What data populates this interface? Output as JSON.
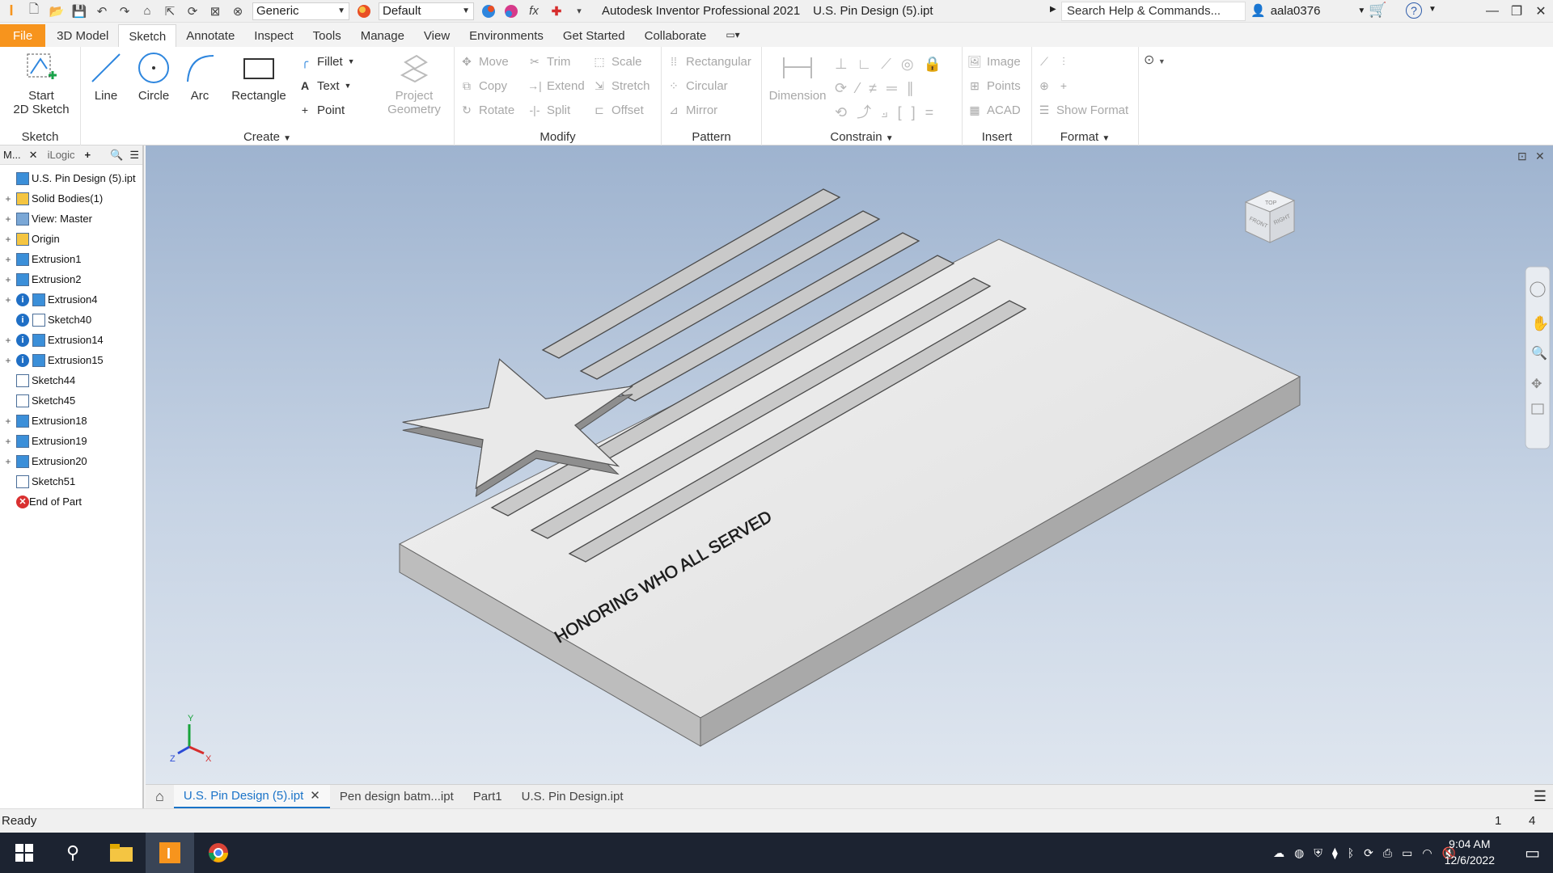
{
  "titlebar": {
    "material": "Generic",
    "appearance": "Default",
    "app_title": "Autodesk Inventor Professional 2021",
    "doc_title": "U.S. Pin Design (5).ipt",
    "search_placeholder": "Search Help & Commands...",
    "user": "aala0376"
  },
  "tabs": [
    "File",
    "3D Model",
    "Sketch",
    "Annotate",
    "Inspect",
    "Tools",
    "Manage",
    "View",
    "Environments",
    "Get Started",
    "Collaborate"
  ],
  "active_tab": "Sketch",
  "ribbon": {
    "sketch_panel": {
      "start_sketch": "Start",
      "start_sketch2": "2D Sketch",
      "label": "Sketch"
    },
    "create_panel": {
      "line": "Line",
      "circle": "Circle",
      "arc": "Arc",
      "rectangle": "Rectangle",
      "fillet": "Fillet",
      "text": "Text",
      "point": "Point",
      "project_geometry": "Project",
      "project_geometry2": "Geometry",
      "label": "Create"
    },
    "modify_panel": {
      "move": "Move",
      "copy": "Copy",
      "rotate": "Rotate",
      "trim": "Trim",
      "extend": "Extend",
      "split": "Split",
      "scale": "Scale",
      "stretch": "Stretch",
      "offset": "Offset",
      "label": "Modify"
    },
    "pattern_panel": {
      "rectangular": "Rectangular",
      "circular": "Circular",
      "mirror": "Mirror",
      "label": "Pattern"
    },
    "constrain_panel": {
      "dimension": "Dimension",
      "label": "Constrain"
    },
    "insert_panel": {
      "image": "Image",
      "points": "Points",
      "acad": "ACAD",
      "label": "Insert"
    },
    "format_panel": {
      "show_format": "Show Format",
      "label": "Format"
    }
  },
  "browser": {
    "tab_model": "M...",
    "tab_ilogic": "iLogic",
    "items": [
      {
        "label": "U.S. Pin Design (5).ipt",
        "kind": "part",
        "expand": false,
        "indent": 0
      },
      {
        "label": "Solid Bodies(1)",
        "kind": "folder",
        "expand": true,
        "indent": 0
      },
      {
        "label": "View: Master",
        "kind": "view",
        "expand": true,
        "indent": 0
      },
      {
        "label": "Origin",
        "kind": "folder",
        "expand": true,
        "indent": 0
      },
      {
        "label": "Extrusion1",
        "kind": "extrusion",
        "expand": true,
        "indent": 0
      },
      {
        "label": "Extrusion2",
        "kind": "extrusion",
        "expand": true,
        "indent": 0
      },
      {
        "label": "Extrusion4",
        "kind": "extrusion-info",
        "expand": true,
        "indent": 0
      },
      {
        "label": "Sketch40",
        "kind": "sketch-info",
        "expand": false,
        "indent": 0
      },
      {
        "label": "Extrusion14",
        "kind": "extrusion-info",
        "expand": true,
        "indent": 0
      },
      {
        "label": "Extrusion15",
        "kind": "extrusion-info",
        "expand": true,
        "indent": 0
      },
      {
        "label": "Sketch44",
        "kind": "sketch",
        "expand": false,
        "indent": 0
      },
      {
        "label": "Sketch45",
        "kind": "sketch",
        "expand": false,
        "indent": 0
      },
      {
        "label": "Extrusion18",
        "kind": "extrusion",
        "expand": true,
        "indent": 0
      },
      {
        "label": "Extrusion19",
        "kind": "extrusion",
        "expand": true,
        "indent": 0
      },
      {
        "label": "Extrusion20",
        "kind": "extrusion",
        "expand": true,
        "indent": 0
      },
      {
        "label": "Sketch51",
        "kind": "sketch",
        "expand": false,
        "indent": 0
      },
      {
        "label": "End of Part",
        "kind": "end",
        "expand": false,
        "indent": 0
      }
    ]
  },
  "model": {
    "engraved_text": "HONORING WHO ALL SERVED"
  },
  "viewcube": {
    "top": "TOP",
    "front": "FRONT",
    "right": "RIGHT"
  },
  "doc_tabs": [
    "U.S. Pin Design (5).ipt",
    "Pen design batm...ipt",
    "Part1",
    "U.S. Pin Design.ipt"
  ],
  "status": {
    "text": "Ready",
    "count1": "1",
    "count2": "4"
  },
  "taskbar": {
    "time": "9:04 AM",
    "date": "12/6/2022"
  },
  "colors": {
    "file_tab": "#f7941d",
    "accent": "#1a73c8",
    "viewport_top": "#9eb3cf",
    "viewport_bottom": "#dfe6ef",
    "taskbar": "#1c2331"
  }
}
